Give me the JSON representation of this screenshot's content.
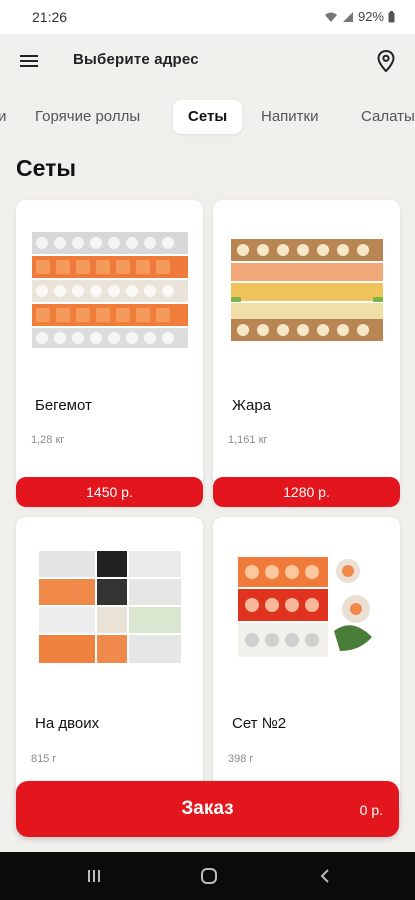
{
  "status_bar": {
    "time": "21:26",
    "battery": "92%"
  },
  "header": {
    "title": "Выберите адрес",
    "menu_icon": "hamburger-menu-icon",
    "location_icon": "map-pin-icon"
  },
  "tabs": [
    {
      "label": "и",
      "active": false
    },
    {
      "label": "Горячие роллы",
      "active": false
    },
    {
      "label": "Сеты",
      "active": true
    },
    {
      "label": "Напитки",
      "active": false
    },
    {
      "label": "Салаты",
      "active": false
    }
  ],
  "section": {
    "title": "Сеты"
  },
  "products": [
    {
      "name": "Бегемот",
      "weight": "1,28 кг",
      "price": "1450 р."
    },
    {
      "name": "Жара",
      "weight": "1,161 кг",
      "price": "1280 р."
    },
    {
      "name": "На двоих",
      "weight": "815 г",
      "price": ""
    },
    {
      "name": "Сет №2",
      "weight": "398 г",
      "price": ""
    }
  ],
  "order": {
    "label": "Заказ",
    "total": "0 р."
  },
  "colors": {
    "accent": "#e3161e",
    "background": "#f0efec",
    "card": "#ffffff"
  }
}
